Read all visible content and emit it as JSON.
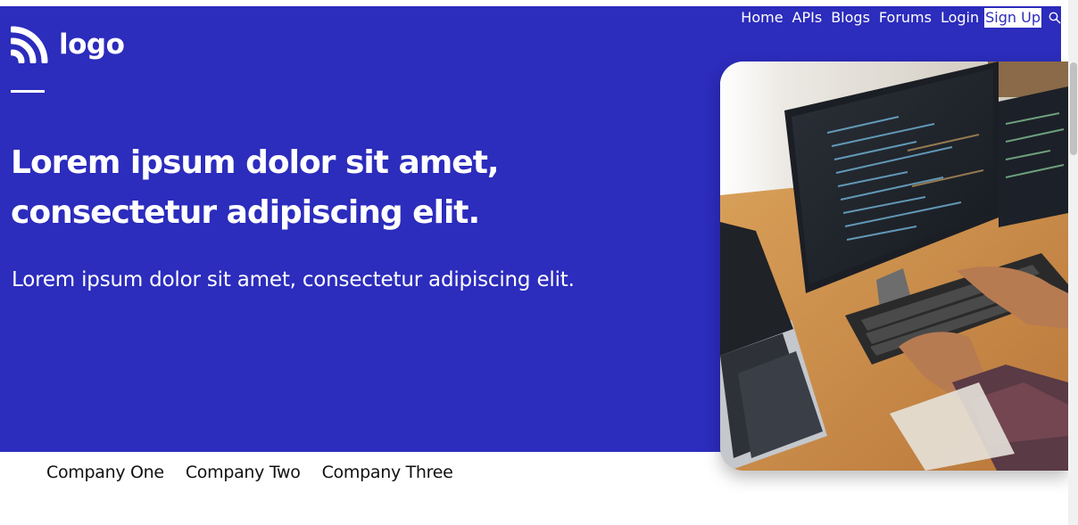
{
  "header": {
    "logo_text": "logo",
    "nav": [
      {
        "label": "Home"
      },
      {
        "label": "APIs"
      },
      {
        "label": "Blogs"
      },
      {
        "label": "Forums"
      },
      {
        "label": "Login"
      },
      {
        "label": "Sign Up"
      }
    ],
    "search_icon": "search-icon"
  },
  "hero": {
    "headline_line1": "Lorem ipsum dolor sit amet,",
    "headline_line2": "consectetur adipiscing elit.",
    "subheading": "Lorem ipsum dolor sit amet, consectetur adipiscing elit.",
    "image_subject": "developer-at-computer-photo"
  },
  "companies": [
    {
      "name": "Company One"
    },
    {
      "name": "Company Two"
    },
    {
      "name": "Company Three"
    }
  ],
  "colors": {
    "hero_bg": "#2c2cbd",
    "text_light": "#ffffff",
    "text_dark": "#111111"
  }
}
